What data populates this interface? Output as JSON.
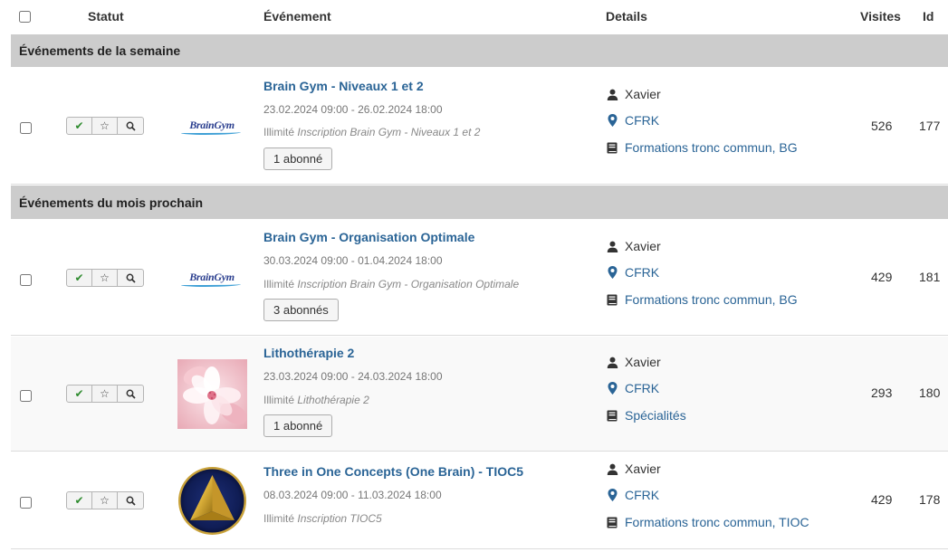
{
  "header": {
    "statut": "Statut",
    "evenement": "Événement",
    "details": "Details",
    "visites": "Visites",
    "id": "Id"
  },
  "groups": [
    {
      "label": "Événements de la semaine"
    },
    {
      "label": "Événements du mois prochain"
    }
  ],
  "logos": {
    "braingym": "BrainGym"
  },
  "events": [
    {
      "title": "Brain Gym - Niveaux 1 et 2",
      "dates": "23.02.2024 09:00 - 26.02.2024 18:00",
      "limit": "Illimité",
      "inscription": "Inscription Brain Gym - Niveaux 1 et 2",
      "subscribers": "1 abonné",
      "person": "Xavier",
      "location": "CFRK",
      "category": "Formations tronc commun, BG",
      "visits": "526",
      "id": "177"
    },
    {
      "title": "Brain Gym - Organisation Optimale",
      "dates": "30.03.2024 09:00 - 01.04.2024 18:00",
      "limit": "Illimité",
      "inscription": "Inscription Brain Gym - Organisation Optimale",
      "subscribers": "3 abonnés",
      "person": "Xavier",
      "location": "CFRK",
      "category": "Formations tronc commun, BG",
      "visits": "429",
      "id": "181"
    },
    {
      "title": "Lithothérapie 2",
      "dates": "23.03.2024 09:00 - 24.03.2024 18:00",
      "limit": "Illimité",
      "inscription": "Lithothérapie 2",
      "subscribers": "1 abonné",
      "person": "Xavier",
      "location": "CFRK",
      "category": "Spécialités",
      "visits": "293",
      "id": "180"
    },
    {
      "title": "Three in One Concepts (One Brain) - TIOC5",
      "dates": "08.03.2024 09:00 - 11.03.2024 18:00",
      "limit": "Illimité",
      "inscription": "Inscription TIOC5",
      "person": "Xavier",
      "location": "CFRK",
      "category": "Formations tronc commun, TIOC",
      "visits": "429",
      "id": "178"
    }
  ],
  "colors": {
    "link": "#2a6496",
    "group_bg": "#cccccc",
    "check": "#2e8b2e"
  }
}
